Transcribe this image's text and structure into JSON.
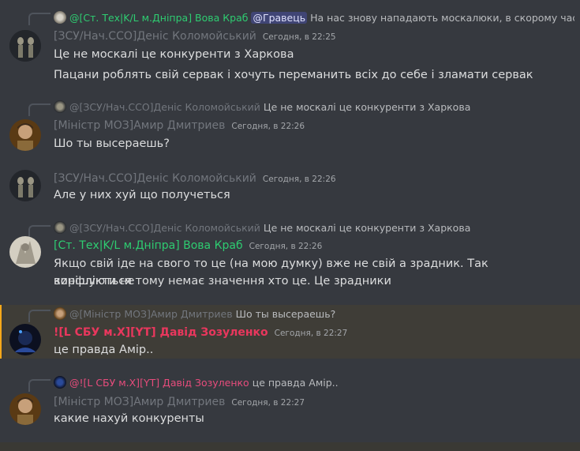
{
  "messages": [
    {
      "reply": {
        "author": "@[Ст. Тех|K/L м.Дніпра] Вова Краб",
        "mention": "@Гравець",
        "text": "На нас знову нападають москалюки, в скорому час"
      },
      "author": "[ЗСУ/Нач.ССО]Деніс Коломойський",
      "timestamp": "Сегодня, в 22:25",
      "lines": [
        "Це не москалі це конкуренти з Харкова",
        "Пацани роблять свій сервак і хочуть переманить всіх до себе і зламати сервак"
      ]
    },
    {
      "reply": {
        "author": "@[ЗСУ/Нач.ССО]Деніс Коломойський",
        "text": "Це не москалі це конкуренти з Харкова"
      },
      "author": "[Міністр МОЗ]Амир Дмитриев",
      "timestamp": "Сегодня, в 22:26",
      "lines": [
        "Шо ты высераешь?"
      ]
    },
    {
      "author": "[ЗСУ/Нач.ССО]Деніс Коломойський",
      "timestamp": "Сегодня, в 22:26",
      "lines": [
        "Але у них хуй що получеться"
      ]
    },
    {
      "reply": {
        "author": "@[ЗСУ/Нач.ССО]Деніс Коломойський",
        "text": "Це не москалі це конкуренти з Харкова"
      },
      "author": "[Ст. Тех|K/L м.Дніпра] Вова Краб",
      "timestamp": "Сегодня, в 22:26",
      "lines": [
        "Якщо свій іде на свого то це (на мою думку) вже не свій а зрадник. Так конфлікти не",
        "вирішуються тому немає значення хто це. Це зрадники"
      ]
    },
    {
      "reply": {
        "author": "@[Міністр МОЗ]Амир Дмитриев",
        "text": "Шо ты высераешь?"
      },
      "author": "![L СБУ м.X][YT] Давід Зозуленко",
      "timestamp": "Сегодня, в 22:27",
      "lines": [
        "це правда Амір.."
      ]
    },
    {
      "reply": {
        "author": "@![L СБУ м.X][YT] Давід Зозуленко",
        "text": "це правда Амір.."
      },
      "author": "[Міністр МОЗ]Амир Дмитриев",
      "timestamp": "Сегодня, в 22:27",
      "lines": [
        "какие нахуй конкуренты"
      ]
    }
  ],
  "colors": {
    "background": "#36393f",
    "highlight": "#3f3d37",
    "highlight_bar": "#faa81a",
    "role_green": "#2ecc71",
    "role_red": "#e9375d",
    "role_gray": "#72767d"
  }
}
